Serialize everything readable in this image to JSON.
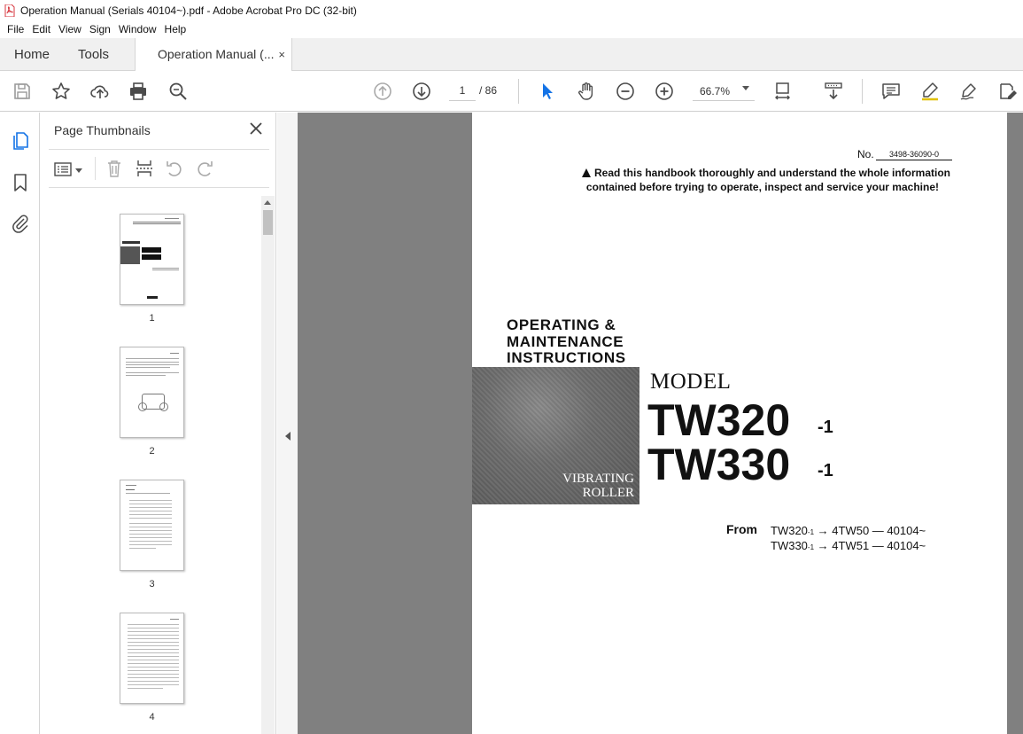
{
  "window": {
    "title": "Operation Manual (Serials 40104~).pdf - Adobe Acrobat Pro DC (32-bit)"
  },
  "menu": [
    "File",
    "Edit",
    "View",
    "Sign",
    "Window",
    "Help"
  ],
  "tabs": {
    "home": "Home",
    "tools": "Tools",
    "document": "Operation Manual (...",
    "close": "×"
  },
  "toolbar": {
    "current_page": "1",
    "page_total": "/ 86",
    "zoom": "66.7%"
  },
  "panel": {
    "title": "Page Thumbnails",
    "thumbnails": [
      {
        "label": "1"
      },
      {
        "label": "2"
      },
      {
        "label": "3"
      },
      {
        "label": "4"
      }
    ]
  },
  "document": {
    "no_label": "No.",
    "no_value": "3498-36090-0",
    "warning_line1": "Read this handbook thoroughly and understand the whole information",
    "warning_line2": "contained before trying to operate, inspect and service your machine!",
    "heading1": "OPERATING  &",
    "heading2": "MAINTENANCE",
    "heading3": "INSTRUCTIONS",
    "photo_caption1": "VIBRATING",
    "photo_caption2": "ROLLER",
    "model_label": "MODEL",
    "model1": "TW320",
    "model1_suffix": "-1",
    "model2": "TW330",
    "model2_suffix": "-1",
    "from_label": "From",
    "serial1_model": "TW320",
    "serial1_suffix": "-1",
    "serial1_rest": "→ 4TW50 — 40104~",
    "serial2_model": "TW330",
    "serial2_suffix": "-1",
    "serial2_rest": "→ 4TW51 — 40104~"
  },
  "colors": {
    "accent_blue": "#1473e6",
    "acrobat_red": "#d7373f",
    "icon_gray": "#4b4b4b",
    "doc_background": "#808080"
  }
}
